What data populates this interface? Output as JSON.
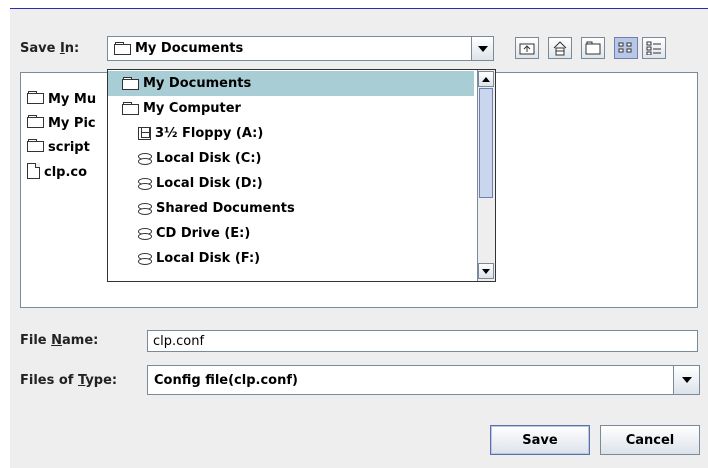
{
  "save_in": {
    "label_pre": "Save ",
    "label_mnemonic": "I",
    "label_post": "n:",
    "selected": "My Documents"
  },
  "toolbar": {
    "up_one_level": "up-folder-icon",
    "home": "home-icon",
    "new_folder": "new-folder-icon",
    "list_view": "list-view-icon",
    "details_view": "details-view-icon"
  },
  "file_list": {
    "items": [
      {
        "name": "My Mu",
        "icon": "folder-icon"
      },
      {
        "name": "My Pic",
        "icon": "folder-icon"
      },
      {
        "name": "script",
        "icon": "folder-icon"
      },
      {
        "name": "clp.co",
        "icon": "file-icon"
      }
    ]
  },
  "dropdown": {
    "items": [
      {
        "label": "My Documents",
        "icon": "folder-icon",
        "selected": true
      },
      {
        "label": "My Computer",
        "icon": "folder-icon",
        "selected": false
      },
      {
        "label": "3½ Floppy (A:)",
        "icon": "floppy-icon",
        "selected": false
      },
      {
        "label": "Local Disk (C:)",
        "icon": "disk-icon",
        "selected": false
      },
      {
        "label": "Local Disk (D:)",
        "icon": "disk-icon",
        "selected": false
      },
      {
        "label": "Shared Documents",
        "icon": "disk-icon",
        "selected": false
      },
      {
        "label": "CD Drive (E:)",
        "icon": "disk-icon",
        "selected": false
      },
      {
        "label": "Local Disk (F:)",
        "icon": "disk-icon",
        "selected": false
      }
    ]
  },
  "file_name": {
    "label_pre": "File ",
    "label_mnemonic": "N",
    "label_post": "ame:",
    "value": "clp.conf"
  },
  "files_of_type": {
    "label_pre": "Files of ",
    "label_mnemonic": "T",
    "label_post": "ype:",
    "selected": "Config file(clp.conf)"
  },
  "buttons": {
    "save": "Save",
    "cancel": "Cancel"
  },
  "colors": {
    "background": "#eeeeee",
    "selection": "#a8cdd4",
    "border": "#7a8a99"
  }
}
